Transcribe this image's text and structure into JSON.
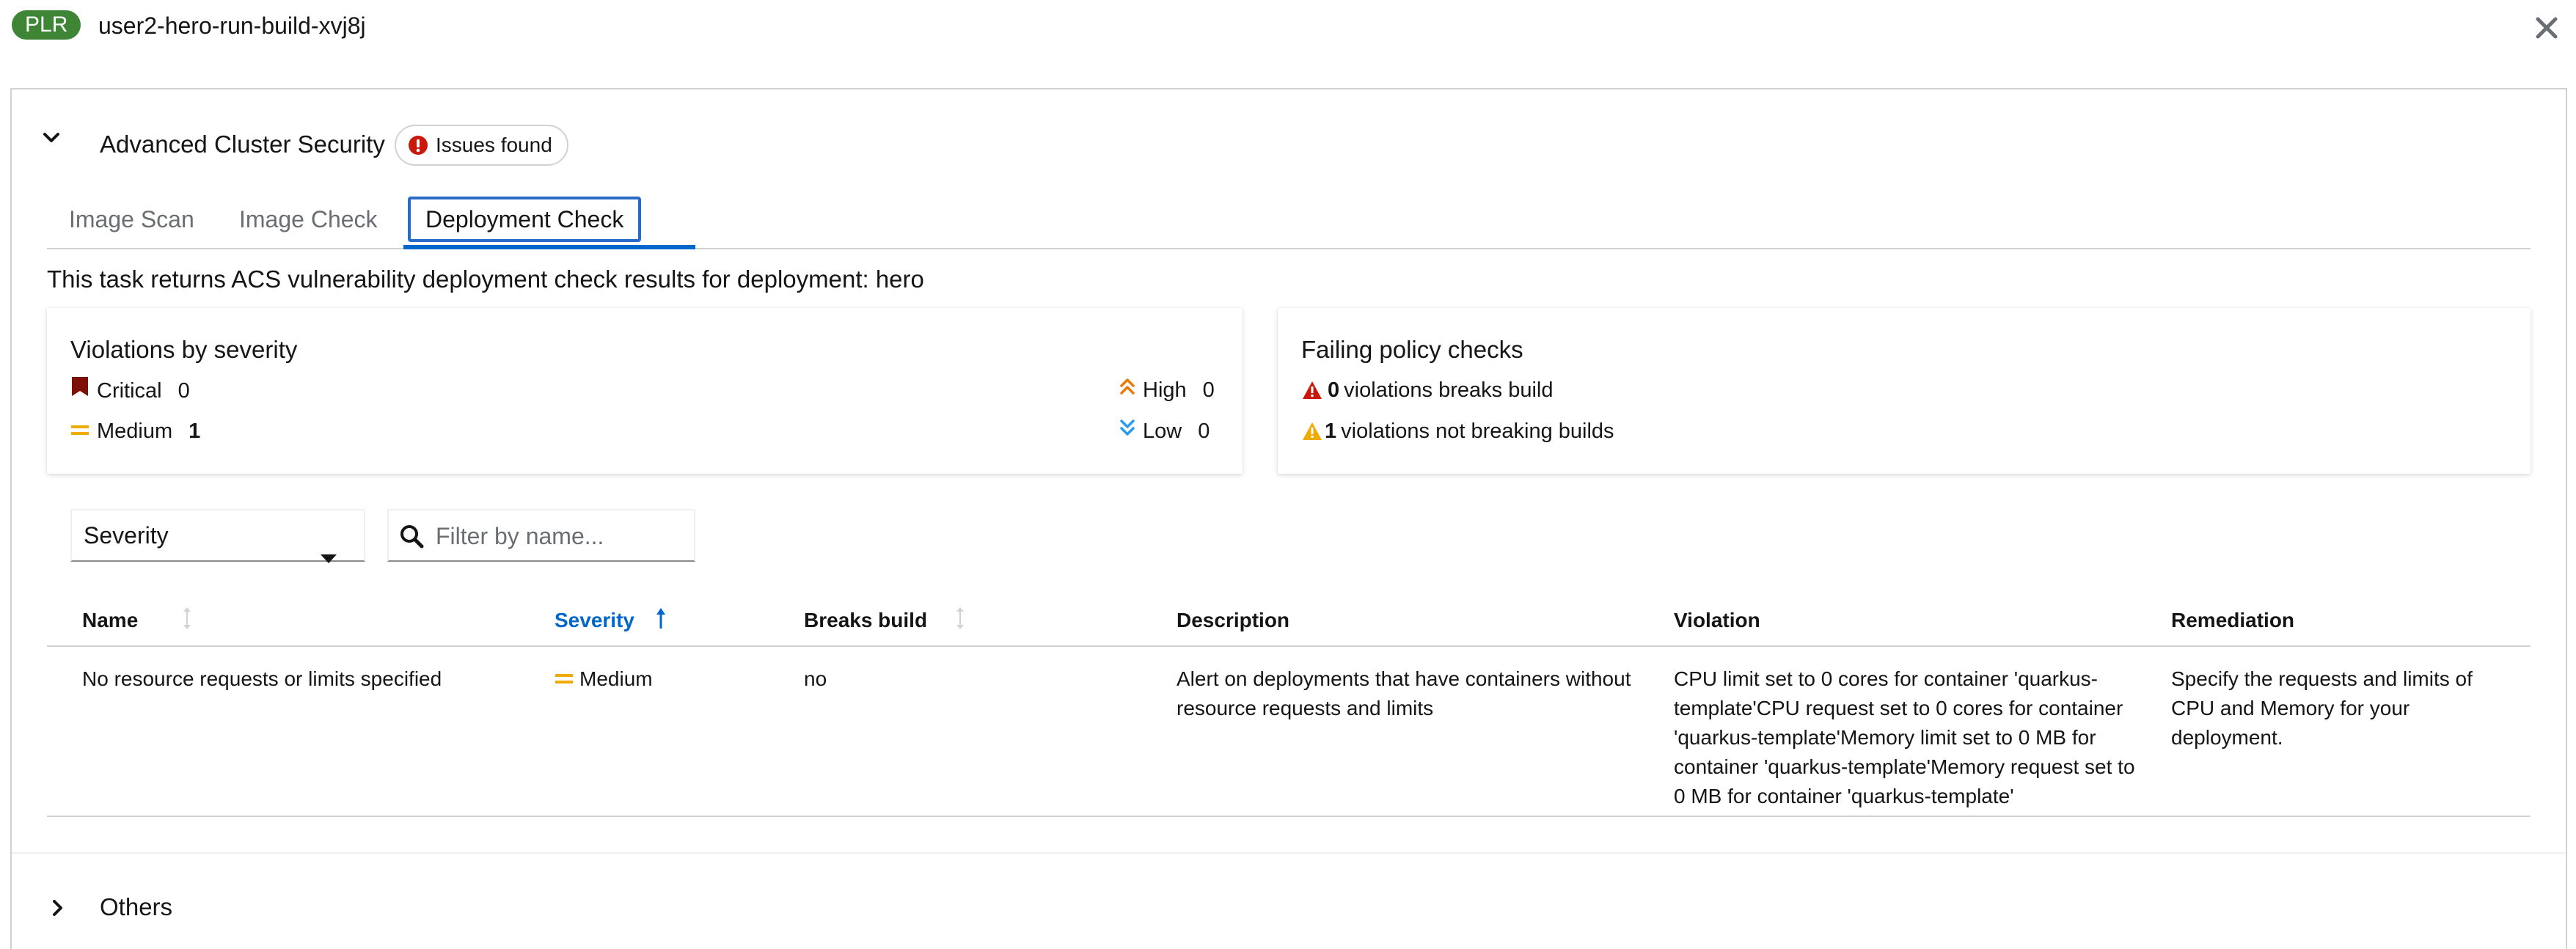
{
  "header": {
    "badge": "PLR",
    "title": "user2-hero-run-build-xvj8j"
  },
  "section": {
    "title": "Advanced Cluster Security",
    "status_badge": "Issues found"
  },
  "tabs": [
    {
      "label": "Image Scan",
      "active": false
    },
    {
      "label": "Image Check",
      "active": false
    },
    {
      "label": "Deployment Check",
      "active": true
    }
  ],
  "task_description": "This task returns ACS vulnerability deployment check results for deployment: hero",
  "violations_card": {
    "title": "Violations by severity",
    "critical": {
      "label": "Critical",
      "value": "0"
    },
    "medium": {
      "label": "Medium",
      "value": "1"
    },
    "high": {
      "label": "High",
      "value": "0"
    },
    "low": {
      "label": "Low",
      "value": "0"
    }
  },
  "failing_card": {
    "title": "Failing policy checks",
    "breaks_count": "0",
    "breaks_text": "violations breaks build",
    "not_breaking_count": "1",
    "not_breaking_text": "violations not breaking builds"
  },
  "toolbar": {
    "severity_select": "Severity",
    "filter_placeholder": "Filter by name..."
  },
  "table": {
    "columns": [
      "Name",
      "Severity",
      "Breaks build",
      "Description",
      "Violation",
      "Remediation"
    ],
    "rows": [
      {
        "name": "No resource requests or limits specified",
        "severity": "Medium",
        "breaks_build": "no",
        "description": "Alert on deployments that have containers without resource requests and limits",
        "violation": "CPU limit set to 0 cores for container 'quarkus-template'CPU request set to 0 cores for container 'quarkus-template'Memory limit set to 0 MB for container 'quarkus-template'Memory request set to 0 MB for container 'quarkus-template'",
        "remediation": "Specify the requests and limits of CPU and Memory for your deployment."
      }
    ]
  },
  "others": {
    "title": "Others"
  },
  "colors": {
    "plr_badge": "#3e8635",
    "danger": "#c9190b",
    "critical": "#7d1007",
    "warning": "#f0ab00",
    "high": "#ec7a08",
    "low": "#2b9af3",
    "link": "#0066cc"
  },
  "icons": {
    "close": "close-icon",
    "section_toggle": "chevron-down-icon",
    "issues": "exclamation-circle-icon",
    "critical": "critical-shield-icon",
    "medium": "equals-icon",
    "high": "angle-double-up-icon",
    "low": "angle-double-down-icon",
    "breaks": "exclamation-triangle-icon",
    "not_breaking": "exclamation-triangle-icon",
    "search": "search-icon",
    "sort": "arrows-alt-v-icon",
    "sort_active": "long-arrow-up-icon",
    "others_toggle": "chevron-right-icon"
  }
}
